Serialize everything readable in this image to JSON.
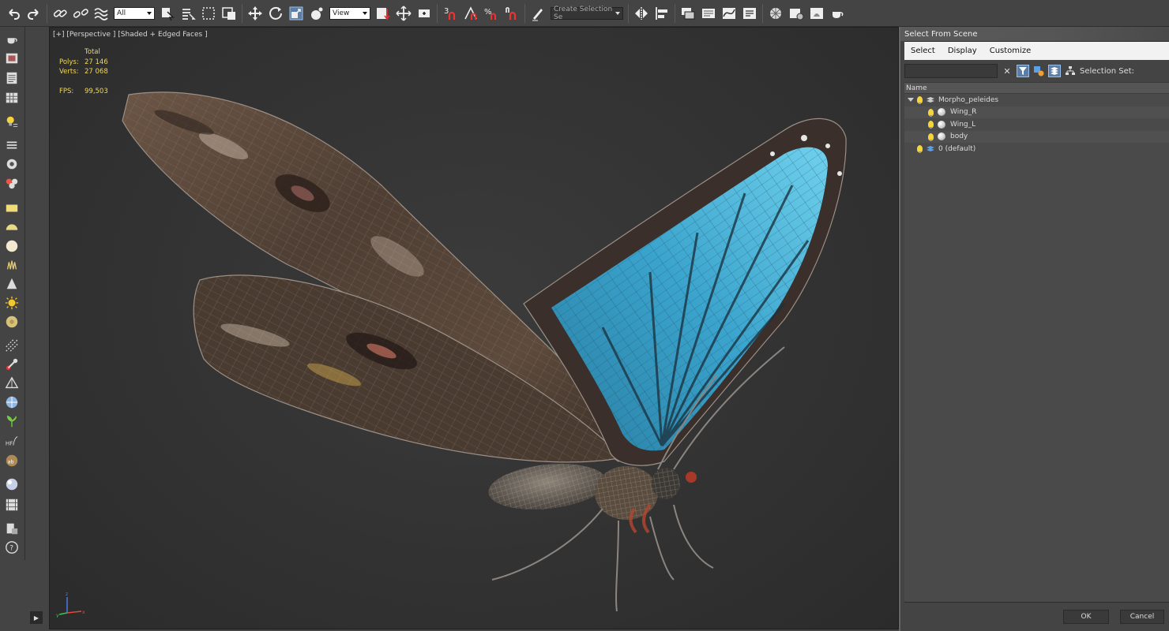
{
  "toolbar": {
    "selection_filter": "All",
    "reference_coordinate_system": "View",
    "named_selection_set_placeholder": "Create Selection Se",
    "snap_toggle_label": "3",
    "icons": [
      "undo-icon",
      "redo-icon",
      "select-and-link-icon",
      "unlink-selection-icon",
      "bind-to-space-warp-icon",
      "select-object-icon",
      "select-by-name-icon",
      "rectangular-selection-icon",
      "window-crossing-icon",
      "select-and-move-icon",
      "select-and-rotate-icon",
      "select-and-scale-icon",
      "select-and-place-icon",
      "use-pivot-point-icon",
      "select-manipulate-icon",
      "keyboard-shortcut-override-icon",
      "snaps-toggle-icon",
      "angle-snap-icon",
      "percent-snap-icon",
      "spinner-snap-icon",
      "edit-named-selection-icon",
      "mirror-icon",
      "align-icon",
      "scene-explorer-icon",
      "layer-explorer-icon",
      "curve-editor-icon",
      "schematic-view-icon",
      "material-editor-icon",
      "render-setup-icon",
      "rendered-frame-window-icon",
      "render-production-icon"
    ]
  },
  "viewport": {
    "label": "[+] [Perspective ] [Shaded + Edged Faces ]",
    "stats": {
      "header": "Total",
      "polys_label": "Polys:",
      "polys_value": "27 146",
      "verts_label": "Verts:",
      "verts_value": "27 068",
      "fps_label": "FPS:",
      "fps_value": "99,503"
    },
    "axis_labels": {
      "x": "x",
      "y": "y",
      "z": "z"
    }
  },
  "dialog": {
    "title": "Select From Scene",
    "menu": [
      "Select",
      "Display",
      "Customize"
    ],
    "search_value": "",
    "selection_set_label": "Selection Set:",
    "column_header": "Name",
    "tree": [
      {
        "label": "Morpho_peleides",
        "level": 0,
        "type": "layer",
        "expanded": true
      },
      {
        "label": "Wing_R",
        "level": 1,
        "type": "object"
      },
      {
        "label": "Wing_L",
        "level": 1,
        "type": "object"
      },
      {
        "label": "body",
        "level": 1,
        "type": "object"
      },
      {
        "label": "0 (default)",
        "level": 0,
        "type": "layer"
      }
    ],
    "ok_label": "OK",
    "cancel_label": "Cancel"
  },
  "colors": {
    "ui_background": "#444444",
    "viewport_background": "#303030",
    "stats_text": "#f0d858",
    "active_tool": "#5c7ea6",
    "wing_blue": "#4fb2d6",
    "wing_brown": "#5a4434"
  }
}
